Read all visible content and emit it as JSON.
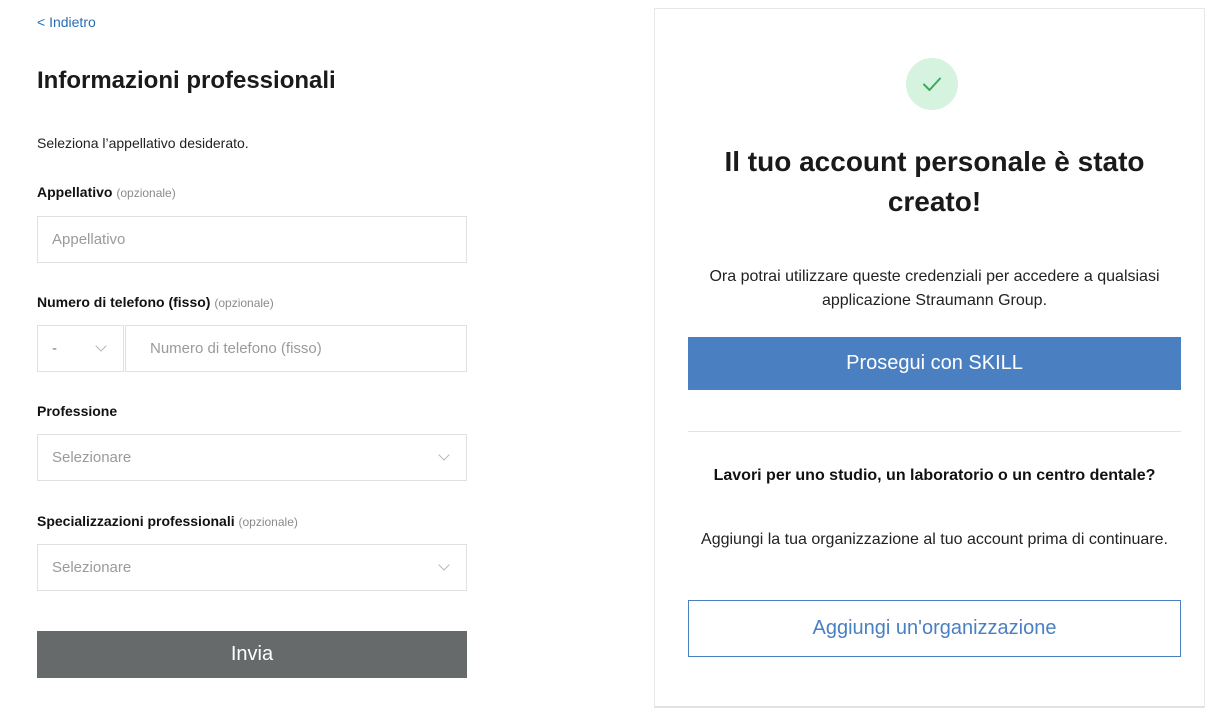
{
  "form": {
    "back_label": "< Indietro",
    "title": "Informazioni professionali",
    "intro": "Seleziona l’appellativo desiderato.",
    "optional_tag": "(opzionale)",
    "title_field": {
      "label": "Appellativo",
      "placeholder": "Appellativo"
    },
    "phone_field": {
      "label": "Numero di telefono (fisso)",
      "prefix_value": "-",
      "placeholder": "Numero di telefono (fisso)"
    },
    "profession_field": {
      "label": "Professione",
      "placeholder": "Selezionare"
    },
    "specializations_field": {
      "label": "Specializzazioni professionali",
      "placeholder": "Selezionare"
    },
    "submit_label": "Invia"
  },
  "success_card": {
    "title": "Il tuo account personale è stato creato!",
    "text": "Ora potrai utilizzare queste credenziali per accedere a qualsiasi applicazione Straumann Group.",
    "primary_button": "Prosegui con SKILL",
    "org_title": "Lavori per uno studio, un laboratorio o un centro dentale?",
    "org_text": "Aggiungi la tua organizzazione al tuo account prima di continuare.",
    "secondary_button": "Aggiungi un'organizzazione",
    "check_icon": "check-icon"
  },
  "colors": {
    "link": "#2a6db5",
    "primary": "#4a7fc1",
    "submit_bg": "#666a6a",
    "success_circle": "#d5f3df",
    "check": "#3aaa5b"
  }
}
